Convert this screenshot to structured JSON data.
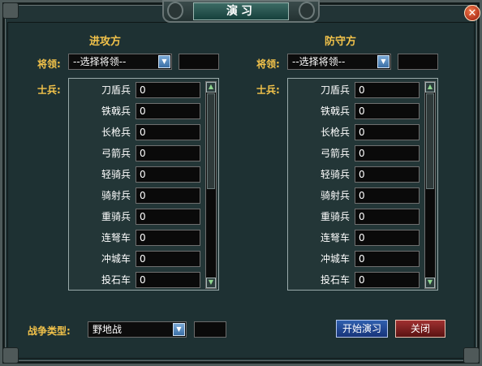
{
  "window": {
    "title": "演习",
    "close_symbol": "✕"
  },
  "attack": {
    "title": "进攻方",
    "general_label": "将领:",
    "general_select": "--选择将领--",
    "soldier_label": "士兵:",
    "units": [
      {
        "name": "刀盾兵",
        "value": "0"
      },
      {
        "name": "铁戟兵",
        "value": "0"
      },
      {
        "name": "长枪兵",
        "value": "0"
      },
      {
        "name": "弓箭兵",
        "value": "0"
      },
      {
        "name": "轻骑兵",
        "value": "0"
      },
      {
        "name": "骑射兵",
        "value": "0"
      },
      {
        "name": "重骑兵",
        "value": "0"
      },
      {
        "name": "连弩车",
        "value": "0"
      },
      {
        "name": "冲城车",
        "value": "0"
      },
      {
        "name": "投石车",
        "value": "0"
      }
    ]
  },
  "defense": {
    "title": "防守方",
    "general_label": "将领:",
    "general_select": "--选择将领--",
    "soldier_label": "士兵:",
    "units": [
      {
        "name": "刀盾兵",
        "value": "0"
      },
      {
        "name": "铁戟兵",
        "value": "0"
      },
      {
        "name": "长枪兵",
        "value": "0"
      },
      {
        "name": "弓箭兵",
        "value": "0"
      },
      {
        "name": "轻骑兵",
        "value": "0"
      },
      {
        "name": "骑射兵",
        "value": "0"
      },
      {
        "name": "重骑兵",
        "value": "0"
      },
      {
        "name": "连弩车",
        "value": "0"
      },
      {
        "name": "冲城车",
        "value": "0"
      },
      {
        "name": "投石车",
        "value": "0"
      }
    ]
  },
  "war": {
    "label": "战争类型:",
    "type": "野地战"
  },
  "buttons": {
    "start": "开始演习",
    "close": "关闭"
  },
  "icons": {
    "dropdown": "chevron-down-icon",
    "scroll_up": "scroll-up-icon",
    "scroll_down": "scroll-down-icon",
    "close": "close-icon"
  },
  "colors": {
    "label_gold": "#f2c24a",
    "panel_bg": "#233637",
    "start_blue": "#2f5fae",
    "close_red": "#a03030"
  }
}
